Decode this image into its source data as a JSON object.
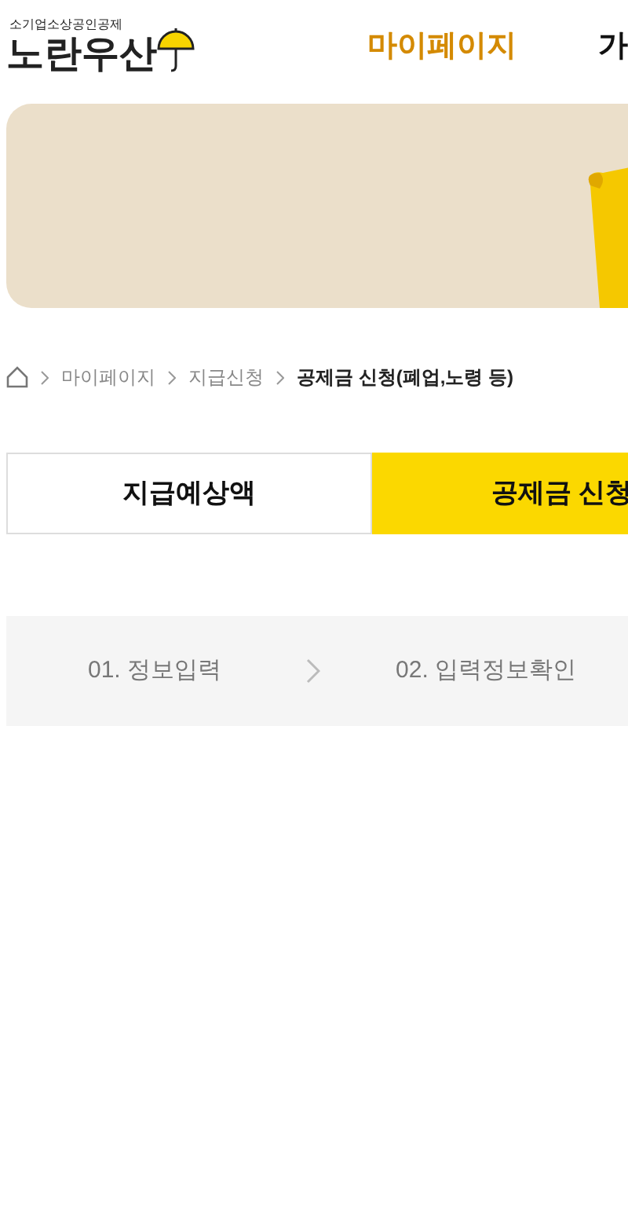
{
  "logo": {
    "subtitle": "소기업소상공인공제",
    "name": "노란우산"
  },
  "nav": [
    {
      "label": "마이페이지",
      "selected": true
    },
    {
      "label": "가",
      "selected": false
    }
  ],
  "breadcrumb": [
    "마이페이지",
    "지급신청",
    "공제금 신청(폐업,노령 등)"
  ],
  "tabs": [
    {
      "label": "지급예상액",
      "selected": false
    },
    {
      "label": "공제금 신청",
      "selected": true
    }
  ],
  "steps": [
    "01. 정보입력",
    "02. 입력정보확인"
  ]
}
